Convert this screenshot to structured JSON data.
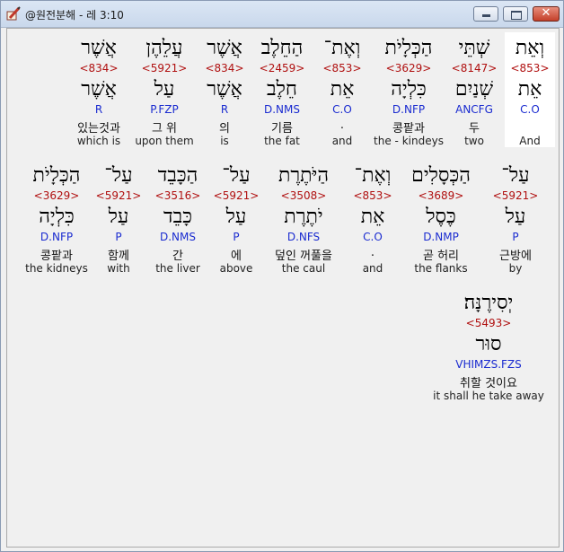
{
  "window": {
    "title": "@원전분해 - 레 3:10",
    "icon": "pencil-book-icon",
    "controls": {
      "minimize": "minimize-icon",
      "maximize": "maximize-icon",
      "close": "✕"
    }
  },
  "words": [
    {
      "heb": "וְאֵת",
      "num": "<853>",
      "lemma": "אֵת",
      "parse": "C.O",
      "kor": "",
      "eng": "And",
      "highlight": true
    },
    {
      "heb": "שְׁתֵּי",
      "num": "<8147>",
      "lemma": "שְׁנַיִם",
      "parse": "ANCFG",
      "kor": "두",
      "eng": "two"
    },
    {
      "heb": "הַכְּלָיֹת",
      "num": "<3629>",
      "lemma": "כִּלְיָה",
      "parse": "D.NFP",
      "kor": "콩팥과",
      "eng": "the - kindeys"
    },
    {
      "heb": "וְאֶת־",
      "num": "<853>",
      "lemma": "אֵת",
      "parse": "C.O",
      "kor": ".",
      "eng": "and"
    },
    {
      "heb": "הַחֵלֶב",
      "num": "<2459>",
      "lemma": "חֵלֶב",
      "parse": "D.NMS",
      "kor": "기름",
      "eng": "the fat"
    },
    {
      "heb": "אֲשֶׁר",
      "num": "<834>",
      "lemma": "אֲשֶׁר",
      "parse": "R",
      "kor": "의",
      "eng": "is"
    },
    {
      "heb": "עֲלֵהֶן",
      "num": "<5921>",
      "lemma": "עַל",
      "parse": "P.FZP",
      "kor": "그 위",
      "eng": "upon them"
    },
    {
      "heb": "אֲשֶׁר",
      "num": "<834>",
      "lemma": "אֲשֶׁר",
      "parse": "R",
      "kor": "있는것과",
      "eng": "which is"
    },
    {
      "heb": "עַל־",
      "num": "<5921>",
      "lemma": "עַל",
      "parse": "P",
      "kor": "근방에",
      "eng": "by"
    },
    {
      "heb": "הַכְּסָלִים",
      "num": "<3689>",
      "lemma": "כֶּסֶל",
      "parse": "D.NMP",
      "kor": "곧 허리",
      "eng": "the flanks"
    },
    {
      "heb": "וְאֶת־",
      "num": "<853>",
      "lemma": "אֵת",
      "parse": "C.O",
      "kor": ".",
      "eng": "and"
    },
    {
      "heb": "הַיֹּתֶרֶת",
      "num": "<3508>",
      "lemma": "יֹתֶרֶת",
      "parse": "D.NFS",
      "kor": "덮인 꺼풀을",
      "eng": "the caul"
    },
    {
      "heb": "עַל־",
      "num": "<5921>",
      "lemma": "עַל",
      "parse": "P",
      "kor": "에",
      "eng": "above"
    },
    {
      "heb": "הַכָּבֵד",
      "num": "<3516>",
      "lemma": "כָּבֵד",
      "parse": "D.NMS",
      "kor": "간",
      "eng": "the liver"
    },
    {
      "heb": "עַל־",
      "num": "<5921>",
      "lemma": "עַל",
      "parse": "P",
      "kor": "함께",
      "eng": "with"
    },
    {
      "heb": "הַכְּלָיֹת",
      "num": "<3629>",
      "lemma": "כִּלְיָה",
      "parse": "D.NFP",
      "kor": "콩팥과",
      "eng": "the kidneys"
    },
    {
      "heb": "יְסִירֶנָּה׃",
      "num": "<5493>",
      "lemma": "סוּר",
      "parse": "VHIMZS.FZS",
      "kor": "취할 것이요",
      "eng": "it shall he take away"
    }
  ]
}
